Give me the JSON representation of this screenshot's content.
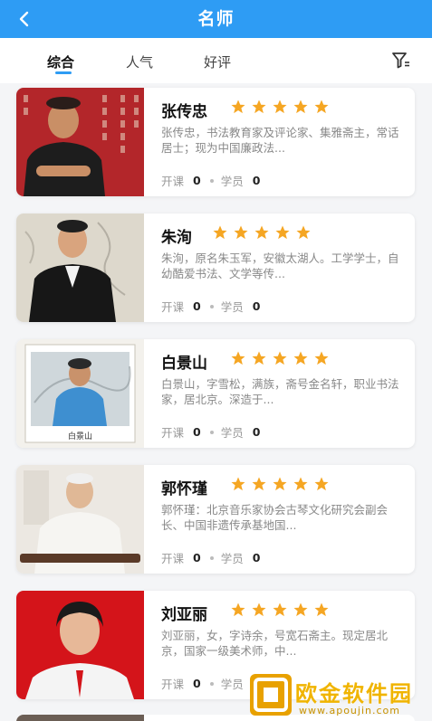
{
  "header": {
    "title": "名师"
  },
  "tabs": [
    {
      "label": "综合",
      "active": true
    },
    {
      "label": "人气",
      "active": false
    },
    {
      "label": "好评",
      "active": false
    }
  ],
  "teachers": [
    {
      "name": "张传忠",
      "rating": 5,
      "desc": "张传忠，书法教育家及评论家、集雅斋主，常话居士；现为中国廉政法...",
      "courses_label": "开课",
      "courses": "0",
      "students_label": "学员",
      "students": "0"
    },
    {
      "name": "朱洵",
      "rating": 5,
      "desc": "朱洵，原名朱玉军，安徽太湖人。工学学士，自幼酷爱书法、文学等传...",
      "courses_label": "开课",
      "courses": "0",
      "students_label": "学员",
      "students": "0"
    },
    {
      "name": "白景山",
      "rating": 5,
      "desc": "白景山，字雪松，满族，斋号金名轩，职业书法家，居北京。深造于...",
      "courses_label": "开课",
      "courses": "0",
      "students_label": "学员",
      "students": "0",
      "photo_caption": "白景山"
    },
    {
      "name": "郭怀瑾",
      "rating": 5,
      "desc": "郭怀瑾：北京音乐家协会古琴文化研究会副会长、中国非遗传承基地国...",
      "courses_label": "开课",
      "courses": "0",
      "students_label": "学员",
      "students": "0"
    },
    {
      "name": "刘亚丽",
      "rating": 5,
      "desc": "刘亚丽，女，字诗余，号宽石斋主。现定居北京，国家一级美术师，中...",
      "courses_label": "开课",
      "courses": "0",
      "students_label": "学员",
      "students": "0"
    }
  ],
  "colors": {
    "accent": "#2e9cf4",
    "star": "#f5a623"
  },
  "watermark": {
    "text": "欧金软件园",
    "url": "www.apoujin.com"
  }
}
